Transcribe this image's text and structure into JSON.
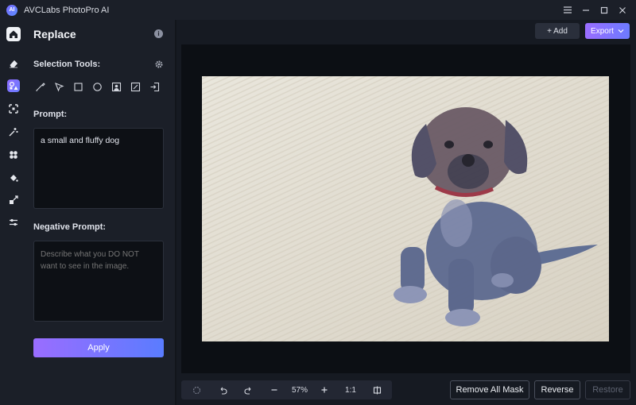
{
  "app": {
    "title": "AVCLabs PhotoPro AI",
    "logo_text": "AI"
  },
  "panel": {
    "title": "Replace",
    "selection_tools_label": "Selection Tools:",
    "prompt_label": "Prompt:",
    "prompt_value": "a small and fluffy dog",
    "negative_prompt_label": "Negative Prompt:",
    "negative_prompt_placeholder": "Describe what you DO NOT want to see in the image.",
    "apply_label": "Apply"
  },
  "toolbar": {
    "add_label": "+ Add",
    "export_label": "Export"
  },
  "bottom": {
    "zoom_value": "57%",
    "ratio_label": "1:1",
    "remove_all_mask_label": "Remove All Mask",
    "reverse_label": "Reverse",
    "restore_label": "Restore"
  },
  "colors": {
    "accent_start": "#9a6dff",
    "accent_end": "#5a7cff",
    "background": "#161a22",
    "panel": "#1b1f28"
  }
}
